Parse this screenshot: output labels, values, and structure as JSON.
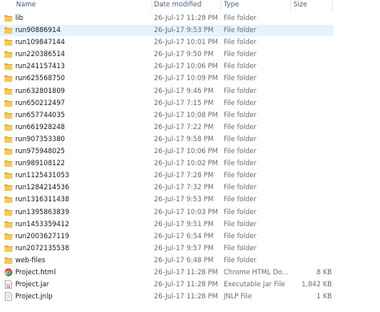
{
  "columns": {
    "name": "Name",
    "date": "Date modified",
    "type": "Type",
    "size": "Size"
  },
  "icons": {
    "folder": "folder-icon",
    "html": "chrome-html-icon",
    "jar": "jar-file-icon",
    "jnlp": "jnlp-file-icon"
  },
  "colors": {
    "selection": "#e5f3ff",
    "folder": "#e8b84c"
  },
  "files": [
    {
      "name": "lib",
      "date": "26-Jul-17 11:29 PM",
      "type": "File folder",
      "size": "",
      "icon": "folder",
      "selected": false
    },
    {
      "name": "run90886914",
      "date": "26-Jul-17 9:53 PM",
      "type": "File folder",
      "size": "",
      "icon": "folder",
      "selected": true
    },
    {
      "name": "run109847144",
      "date": "26-Jul-17 10:01 PM",
      "type": "File folder",
      "size": "",
      "icon": "folder",
      "selected": false
    },
    {
      "name": "run220386514",
      "date": "26-Jul-17 9:50 PM",
      "type": "File folder",
      "size": "",
      "icon": "folder",
      "selected": false
    },
    {
      "name": "run241157413",
      "date": "26-Jul-17 10:06 PM",
      "type": "File folder",
      "size": "",
      "icon": "folder",
      "selected": false
    },
    {
      "name": "run625568750",
      "date": "26-Jul-17 10:09 PM",
      "type": "File folder",
      "size": "",
      "icon": "folder",
      "selected": false
    },
    {
      "name": "run632801809",
      "date": "26-Jul-17 9:46 PM",
      "type": "File folder",
      "size": "",
      "icon": "folder",
      "selected": false
    },
    {
      "name": "run650212497",
      "date": "26-Jul-17 7:15 PM",
      "type": "File folder",
      "size": "",
      "icon": "folder",
      "selected": false
    },
    {
      "name": "run657744035",
      "date": "26-Jul-17 10:08 PM",
      "type": "File folder",
      "size": "",
      "icon": "folder",
      "selected": false
    },
    {
      "name": "run661928248",
      "date": "26-Jul-17 7:22 PM",
      "type": "File folder",
      "size": "",
      "icon": "folder",
      "selected": false
    },
    {
      "name": "run907353380",
      "date": "26-Jul-17 9:58 PM",
      "type": "File folder",
      "size": "",
      "icon": "folder",
      "selected": false
    },
    {
      "name": "run975948025",
      "date": "26-Jul-17 10:06 PM",
      "type": "File folder",
      "size": "",
      "icon": "folder",
      "selected": false
    },
    {
      "name": "run989108122",
      "date": "26-Jul-17 10:02 PM",
      "type": "File folder",
      "size": "",
      "icon": "folder",
      "selected": false
    },
    {
      "name": "run1125431053",
      "date": "26-Jul-17 7:28 PM",
      "type": "File folder",
      "size": "",
      "icon": "folder",
      "selected": false
    },
    {
      "name": "run1284214536",
      "date": "26-Jul-17 7:32 PM",
      "type": "File folder",
      "size": "",
      "icon": "folder",
      "selected": false
    },
    {
      "name": "run1316311438",
      "date": "26-Jul-17 9:53 PM",
      "type": "File folder",
      "size": "",
      "icon": "folder",
      "selected": false
    },
    {
      "name": "run1395863839",
      "date": "26-Jul-17 10:03 PM",
      "type": "File folder",
      "size": "",
      "icon": "folder",
      "selected": false
    },
    {
      "name": "run1453359412",
      "date": "26-Jul-17 9:51 PM",
      "type": "File folder",
      "size": "",
      "icon": "folder",
      "selected": false
    },
    {
      "name": "run2003627119",
      "date": "26-Jul-17 6:54 PM",
      "type": "File folder",
      "size": "",
      "icon": "folder",
      "selected": false
    },
    {
      "name": "run2072135538",
      "date": "26-Jul-17 9:57 PM",
      "type": "File folder",
      "size": "",
      "icon": "folder",
      "selected": false
    },
    {
      "name": "web-files",
      "date": "26-Jul-17 6:48 PM",
      "type": "File folder",
      "size": "",
      "icon": "folder",
      "selected": false
    },
    {
      "name": "Project.html",
      "date": "26-Jul-17 11:28 PM",
      "type": "Chrome HTML Do...",
      "size": "8 KB",
      "icon": "html",
      "selected": false
    },
    {
      "name": "Project.jar",
      "date": "26-Jul-17 11:28 PM",
      "type": "Executable Jar File",
      "size": "1,842 KB",
      "icon": "jar",
      "selected": false
    },
    {
      "name": "Project.jnlp",
      "date": "26-Jul-17 11:28 PM",
      "type": "JNLP File",
      "size": "1 KB",
      "icon": "jnlp",
      "selected": false
    }
  ]
}
